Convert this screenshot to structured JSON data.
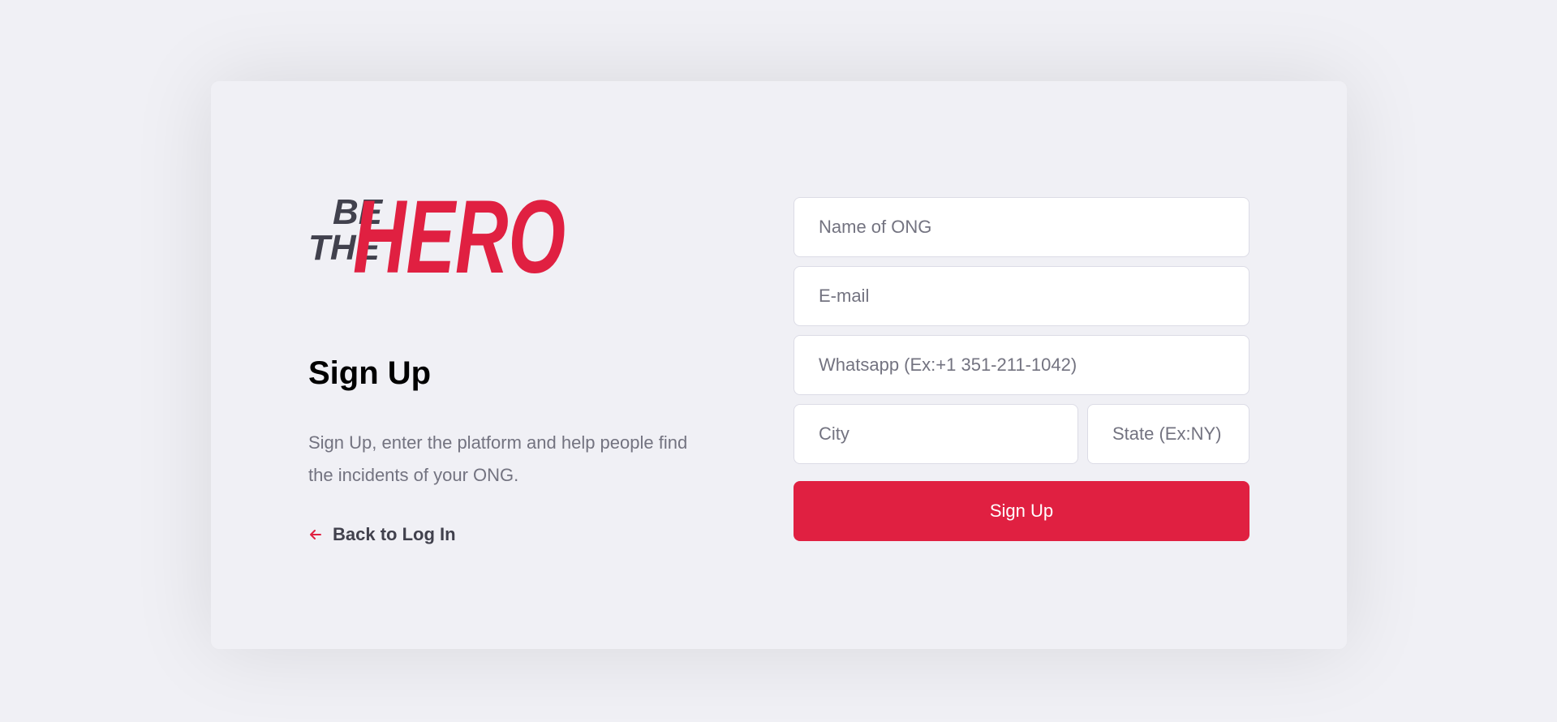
{
  "logo": {
    "line1": "BE",
    "line2": "THE",
    "word": "HERO"
  },
  "title": "Sign Up",
  "description": "Sign Up, enter the platform and help people find the incidents of your ONG.",
  "back_link": {
    "label": "Back to Log In",
    "icon": "arrow-left-icon"
  },
  "form": {
    "name_placeholder": "Name of ONG",
    "email_placeholder": "E-mail",
    "whatsapp_placeholder": "Whatsapp (Ex:+1 351-211-1042)",
    "city_placeholder": "City",
    "state_placeholder": "State (Ex:NY)",
    "submit_label": "Sign Up"
  },
  "colors": {
    "brand": "#e02041",
    "background": "#f0f0f5",
    "text_dark": "#41414d",
    "text_muted": "#737380"
  }
}
